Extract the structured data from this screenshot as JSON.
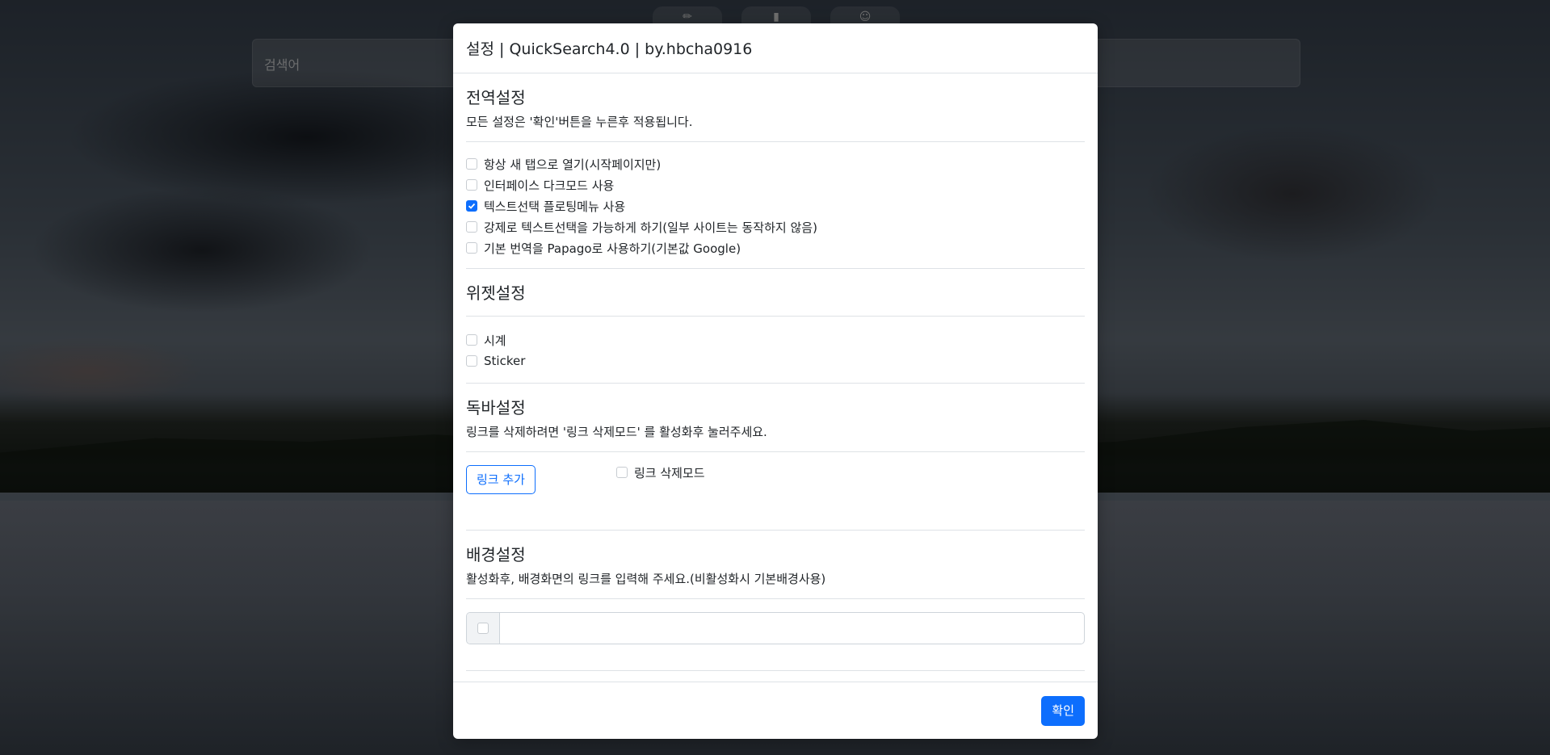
{
  "background": {
    "search_placeholder": "검색어",
    "favorites": [
      "✏",
      "▮",
      "☺"
    ]
  },
  "modal": {
    "title": "설정 | QuickSearch4.0 | by.hbcha0916",
    "global": {
      "title": "전역설정",
      "desc": "모든 설정은 '확인'버튼을 누른후 적용됩니다.",
      "options": [
        {
          "label": "항상 새 탭으로 열기(시작페이지만)",
          "checked": false
        },
        {
          "label": "인터페이스 다크모드 사용",
          "checked": false
        },
        {
          "label": "텍스트선택 플로팅메뉴 사용",
          "checked": true
        },
        {
          "label": "강제로 텍스트선택을 가능하게 하기(일부 사이트는 동작하지 않음)",
          "checked": false
        },
        {
          "label": "기본 번역을 Papago로 사용하기(기본값 Google)",
          "checked": false
        }
      ]
    },
    "widget": {
      "title": "위젯설정",
      "options": [
        {
          "label": "시계",
          "checked": false
        },
        {
          "label": "Sticker",
          "checked": false
        }
      ]
    },
    "dock": {
      "title": "독바설정",
      "desc": "링크를 삭제하려면 '링크 삭제모드' 를 활성화후 눌러주세요.",
      "add_link": "링크 추가",
      "delete_mode": "링크 삭제모드"
    },
    "bg": {
      "title": "배경설정",
      "desc": "활성화후, 배경화면의 링크를 입력해 주세요.(비활성화시 기본배경사용)",
      "url_value": ""
    },
    "confirm": "확인"
  },
  "colors": {
    "primary": "#0d6efd",
    "border": "#dee2e6"
  }
}
